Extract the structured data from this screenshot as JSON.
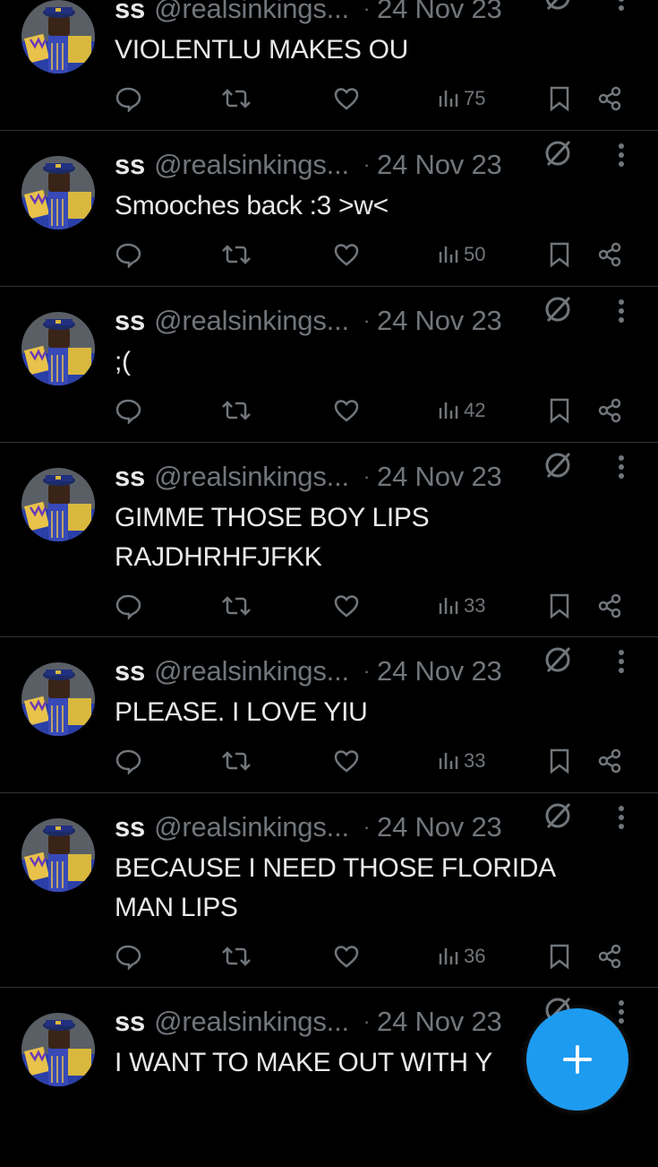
{
  "colors": {
    "background": "#000000",
    "text_primary": "#e7e9ea",
    "text_secondary": "#71767b",
    "divider": "#2f3336",
    "accent": "#1d9bf0"
  },
  "icons": {
    "reply": "reply-icon",
    "retweet": "retweet-icon",
    "like": "heart-icon",
    "views": "views-icon",
    "bookmark": "bookmark-icon",
    "share": "share-icon",
    "grok": "grok-icon",
    "more": "more-icon",
    "compose": "plus-icon"
  },
  "tweets": [
    {
      "name": "ss",
      "handle": "@realsinkings...",
      "dot": "·",
      "date": "24 Nov 23",
      "lines": [
        "VIOLENTLU MAKES OU"
      ],
      "views": "75"
    },
    {
      "name": "ss",
      "handle": "@realsinkings...",
      "dot": "·",
      "date": "24 Nov 23",
      "lines": [
        "Smooches back :3 >w<"
      ],
      "views": "50"
    },
    {
      "name": "ss",
      "handle": "@realsinkings...",
      "dot": "·",
      "date": "24 Nov 23",
      "lines": [
        ";("
      ],
      "views": "42"
    },
    {
      "name": "ss",
      "handle": "@realsinkings...",
      "dot": "·",
      "date": "24 Nov 23",
      "lines": [
        "GIMME THOSE BOY LIPS",
        "RAJDHRHFJFKK"
      ],
      "views": "33"
    },
    {
      "name": "ss",
      "handle": "@realsinkings...",
      "dot": "·",
      "date": "24 Nov 23",
      "lines": [
        "PLEASE. I LOVE YIU"
      ],
      "views": "33"
    },
    {
      "name": "ss",
      "handle": "@realsinkings...",
      "dot": "·",
      "date": "24 Nov 23",
      "lines": [
        "BECAUSE I NEED THOSE FLORIDA",
        "MAN LIPS"
      ],
      "views": "36"
    },
    {
      "name": "ss",
      "handle": "@realsinkings...",
      "dot": "·",
      "date": "24 Nov 23",
      "lines": [
        "I WANT TO MAKE OUT WITH Y"
      ],
      "views": ""
    }
  ]
}
